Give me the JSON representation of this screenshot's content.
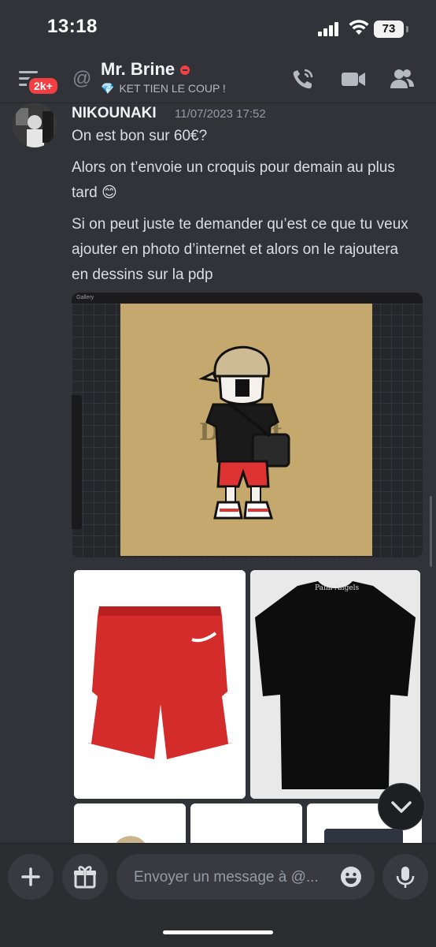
{
  "status_bar": {
    "time": "13:18",
    "battery": "73"
  },
  "header": {
    "badge": "2k+",
    "channel_name": "Mr. Brine",
    "custom_status": "KET TIEN LE COUP !",
    "icons": [
      "hamburger-menu-icon",
      "at-icon",
      "call-icon",
      "video-icon",
      "members-icon"
    ]
  },
  "message": {
    "author": "NIKOUNAKI",
    "timestamp": "11/07/2023 17:52",
    "lines": [
      "On est bon sur 60€?",
      "Alors on t’envoie un croquis pour demain au plus tard 😊",
      "Si on peut juste te demander qu’est ce que tu veux ajouter en photo d’internet et alors on le rajoutera en dessins sur la pdp"
    ]
  },
  "attachment": {
    "app_label": "Gallery",
    "watermark": "Dosfit"
  },
  "shirt_print": "Palm Angels",
  "composer": {
    "placeholder": "Envoyer un message à @..."
  }
}
